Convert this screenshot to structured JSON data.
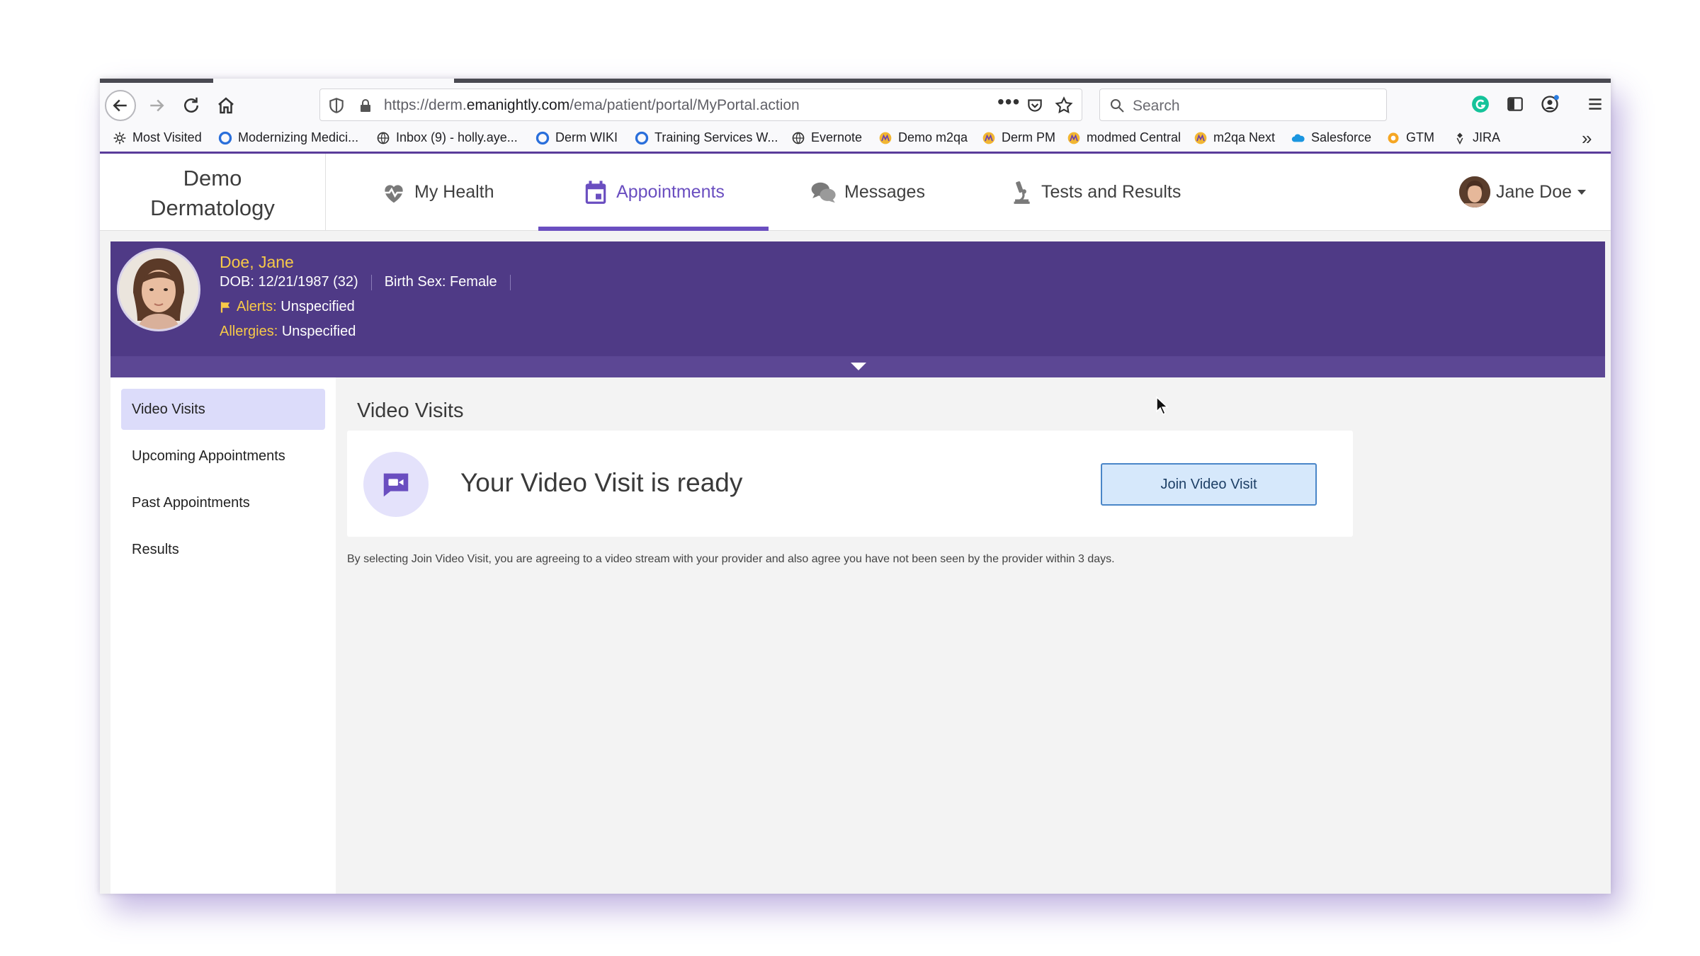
{
  "browser": {
    "url_prefix": "https://derm.",
    "url_domain": "emanightly.com",
    "url_path": "/ema/patient/portal/MyPortal.action",
    "url_menu": "•••",
    "search_placeholder": "Search",
    "bookmarks": [
      {
        "label": "Most Visited",
        "icon": "gear-icon"
      },
      {
        "label": "Modernizing Medici...",
        "icon": "circle-icon"
      },
      {
        "label": "Inbox (9) - holly.aye...",
        "icon": "globe-icon"
      },
      {
        "label": "Derm WIKI",
        "icon": "circle-icon"
      },
      {
        "label": "Training Services W...",
        "icon": "circle-icon"
      },
      {
        "label": "Evernote",
        "icon": "globe-icon"
      },
      {
        "label": "Demo m2qa",
        "icon": "ema-icon"
      },
      {
        "label": "Derm PM",
        "icon": "ema-icon"
      },
      {
        "label": "modmed Central",
        "icon": "ema-icon"
      },
      {
        "label": "m2qa Next",
        "icon": "ema-icon"
      },
      {
        "label": "Salesforce",
        "icon": "cloud-icon"
      },
      {
        "label": "GTM",
        "icon": "gtm-icon"
      },
      {
        "label": "JIRA",
        "icon": "jira-icon"
      }
    ],
    "more_label": "»"
  },
  "header": {
    "practice_name_line1": "Demo",
    "practice_name_line2": "Dermatology",
    "nav": {
      "my_health": "My Health",
      "appointments": "Appointments",
      "messages": "Messages",
      "tests_results": "Tests and Results"
    },
    "user_name": "Jane Doe"
  },
  "patient": {
    "name": "Doe, Jane",
    "dob_label": "DOB:",
    "dob_value": "12/21/1987 (32)",
    "birth_sex_label": "Birth Sex:",
    "birth_sex_value": "Female",
    "alerts_label": "Alerts:",
    "alerts_value": "Unspecified",
    "allergies_label": "Allergies:",
    "allergies_value": "Unspecified"
  },
  "left_nav": {
    "video_visits": "Video Visits",
    "upcoming": "Upcoming Appointments",
    "past": "Past Appointments",
    "results": "Results"
  },
  "main": {
    "section_title": "Video Visits",
    "ready_text": "Your Video Visit is ready",
    "join_button": "Join Video Visit",
    "disclaimer": "By selecting Join Video Visit, you are agreeing to a video stream with your provider and also agree you have not been seen by the provider within 3 days."
  },
  "colors": {
    "brand_purple": "#4f3a86",
    "accent_purple": "#6a4ec0",
    "highlight_yellow": "#f7c948",
    "button_blue": "#d6e8fb"
  }
}
